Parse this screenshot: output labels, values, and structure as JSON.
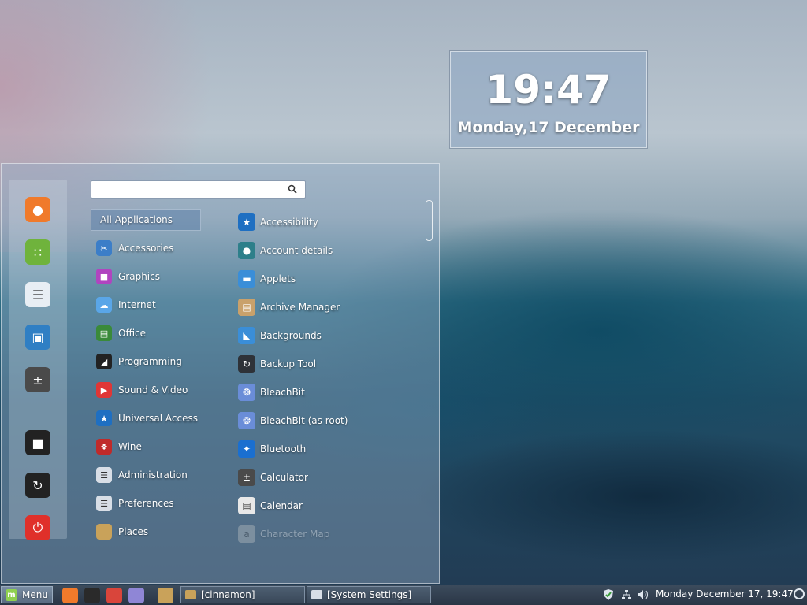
{
  "desklet": {
    "time": "19:47",
    "date": "Monday,17 December"
  },
  "menu": {
    "search": {
      "value": "",
      "placeholder": ""
    },
    "favorites": [
      {
        "name": "firefox-icon",
        "color": "#f07a2b",
        "glyph": "●"
      },
      {
        "name": "software-manager-icon",
        "color": "#6fb33c",
        "glyph": "∷"
      },
      {
        "name": "settings-icon",
        "color": "#e8eef4",
        "glyph": "☰"
      },
      {
        "name": "screenshot-icon",
        "color": "#2f7fc4",
        "glyph": "▣"
      },
      {
        "name": "calculator-icon",
        "color": "#4a4a4a",
        "glyph": "±"
      },
      {
        "name": "lock-screen-icon",
        "color": "#222",
        "glyph": "■"
      },
      {
        "name": "logout-icon",
        "color": "#222",
        "glyph": "↻"
      },
      {
        "name": "power-icon",
        "color": "#e0302a",
        "glyph": "⏻"
      }
    ],
    "categories": [
      {
        "name": "All Applications",
        "selected": true
      },
      {
        "name": "Accessories",
        "color": "#3c7ec8",
        "glyph": "✂"
      },
      {
        "name": "Graphics",
        "color": "#b044c0",
        "glyph": "■"
      },
      {
        "name": "Internet",
        "color": "#5aa6e8",
        "glyph": "☁"
      },
      {
        "name": "Office",
        "color": "#3a8a3a",
        "glyph": "▤"
      },
      {
        "name": "Programming",
        "color": "#222",
        "glyph": "◢"
      },
      {
        "name": "Sound & Video",
        "color": "#e03636",
        "glyph": "▶"
      },
      {
        "name": "Universal Access",
        "color": "#1e6fc2",
        "glyph": "★"
      },
      {
        "name": "Wine",
        "color": "#c02a2a",
        "glyph": "❖"
      },
      {
        "name": "Administration",
        "color": "#d8dee6",
        "glyph": "☰"
      },
      {
        "name": "Preferences",
        "color": "#d8dee6",
        "glyph": "☰"
      },
      {
        "name": "Places",
        "color": "#c9a25a",
        "glyph": ""
      }
    ],
    "apps": [
      {
        "name": "Accessibility",
        "color": "#1e6fc2",
        "glyph": "★"
      },
      {
        "name": "Account details",
        "color": "#2d7f8a",
        "glyph": "●"
      },
      {
        "name": "Applets",
        "color": "#3a8ed8",
        "glyph": "▬"
      },
      {
        "name": "Archive Manager",
        "color": "#c9a16b",
        "glyph": "▤"
      },
      {
        "name": "Backgrounds",
        "color": "#3a8ed8",
        "glyph": "◣"
      },
      {
        "name": "Backup Tool",
        "color": "#2e3238",
        "glyph": "↻"
      },
      {
        "name": "BleachBit",
        "color": "#6a8dd8",
        "glyph": "❂"
      },
      {
        "name": "BleachBit (as root)",
        "color": "#6a8dd8",
        "glyph": "❂"
      },
      {
        "name": "Bluetooth",
        "color": "#1a6fd0",
        "glyph": "✦"
      },
      {
        "name": "Calculator",
        "color": "#4a4a4a",
        "glyph": "±"
      },
      {
        "name": "Calendar",
        "color": "#e8e8e8",
        "glyph": "▤"
      },
      {
        "name": "Character Map",
        "color": "#cccccc",
        "glyph": "a",
        "dim": true
      }
    ]
  },
  "panel": {
    "menu_label": "Menu",
    "launchers": [
      {
        "name": "firefox-launcher-icon",
        "color": "#f07a2b"
      },
      {
        "name": "terminal-launcher-icon",
        "color": "#2a2a2a"
      },
      {
        "name": "chrome-launcher-icon",
        "color": "#d9453b"
      },
      {
        "name": "text-editor-launcher-icon",
        "color": "#8f86d6"
      },
      {
        "name": "files-launcher-icon",
        "color": "#c9a25a"
      }
    ],
    "windows": [
      {
        "title": "[cinnamon]"
      },
      {
        "title": "[System Settings]"
      }
    ],
    "clock": "Monday December 17, 19:47"
  }
}
